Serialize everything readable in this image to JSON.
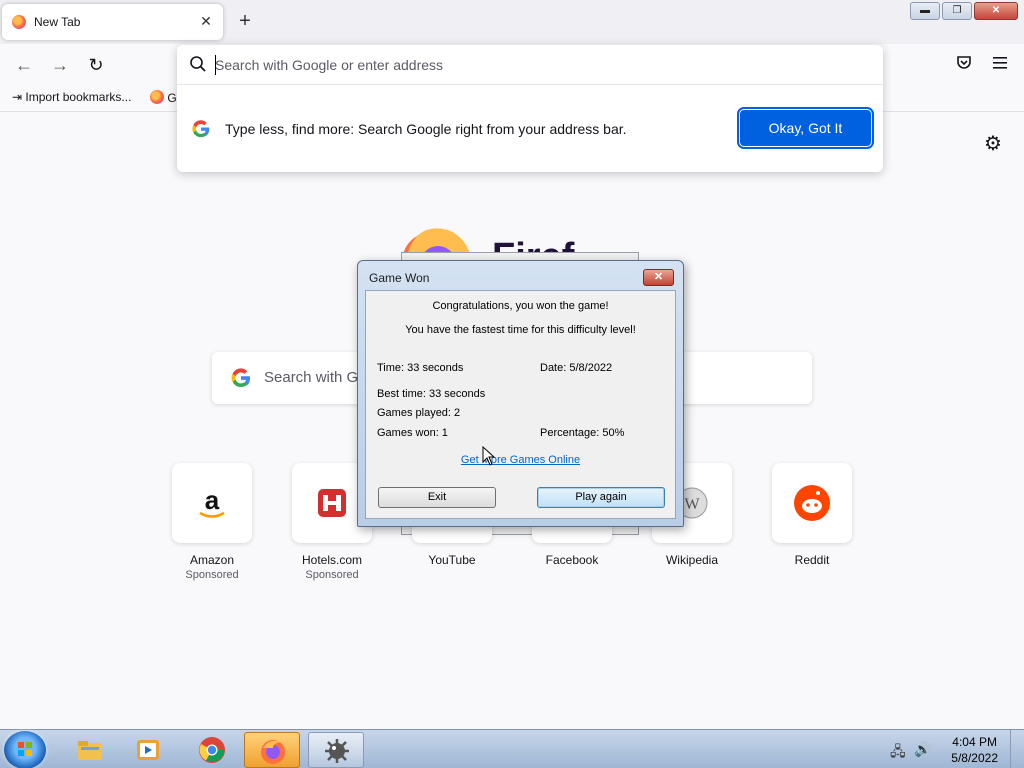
{
  "browser": {
    "tab_title": "New Tab",
    "tab_close": "✕",
    "new_tab": "+",
    "window_buttons": {
      "minimize": "▬",
      "restore": "❐",
      "close": "✕"
    },
    "nav": {
      "back": "←",
      "forward": "→",
      "reload": "↻"
    },
    "bookmarks": [
      {
        "label": "Import bookmarks..."
      },
      {
        "label": "G"
      }
    ],
    "url_placeholder": "Search with Google or enter address",
    "tip_text": "Type less, find more: Search Google right from your address bar.",
    "ok_button": "Okay, Got It",
    "firefox_word": "Firef"
  },
  "newtab": {
    "search_placeholder": "Search with Go",
    "top_sites": [
      {
        "label": "Amazon",
        "sponsored": "Sponsored"
      },
      {
        "label": "Hotels.com",
        "sponsored": "Sponsored"
      },
      {
        "label": "YouTube",
        "sponsored": ""
      },
      {
        "label": "Facebook",
        "sponsored": ""
      },
      {
        "label": "Wikipedia",
        "sponsored": ""
      },
      {
        "label": "Reddit",
        "sponsored": ""
      }
    ]
  },
  "dialog": {
    "title": "Game Won",
    "close": "✕",
    "congrats": "Congratulations, you won the game!",
    "fastest": "You have the fastest time for this difficulty level!",
    "time": "Time: 33 seconds",
    "date": "Date: 5/8/2022",
    "best_time": "Best time: 33 seconds",
    "games_played": "Games played: 2",
    "games_won": "Games won: 1",
    "percentage": "Percentage: 50%",
    "link": "Get More Games Online",
    "exit_button": "Exit",
    "play_again_button": "Play again"
  },
  "taskbar": {
    "time": "4:04 PM",
    "date": "5/8/2022"
  },
  "colors": {
    "accent": "#0061e0",
    "link": "#0066cc",
    "active_taskbar": "#f0a030"
  }
}
